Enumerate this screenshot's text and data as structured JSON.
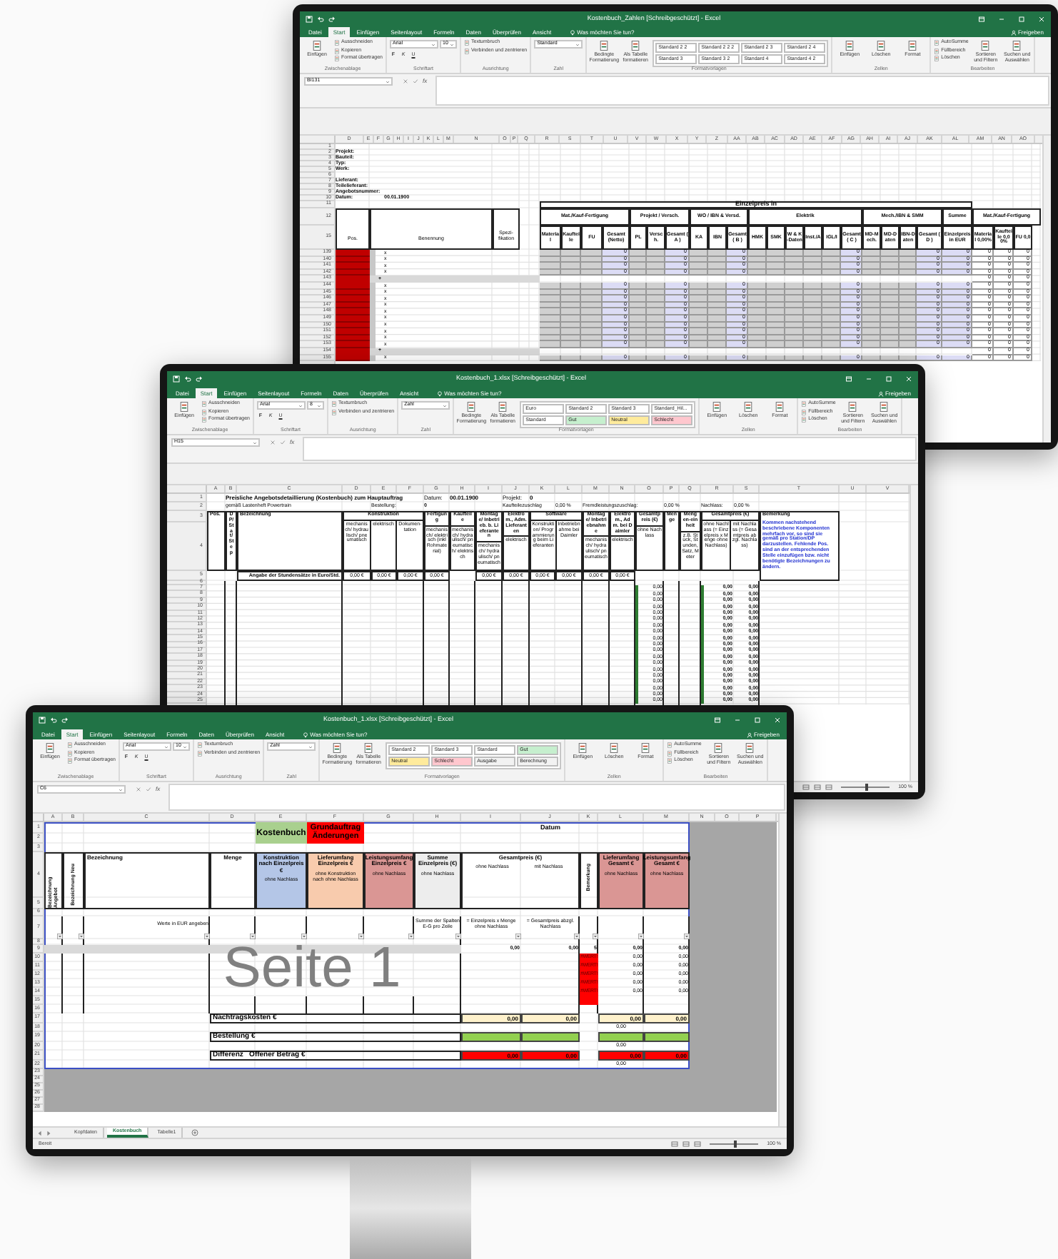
{
  "back_window": {
    "title": "Kostenbuch_Zahlen [Schreibgeschützt] - Excel",
    "tabs": [
      {
        "label": "Datei",
        "selected": false
      },
      {
        "label": "Start",
        "selected": true
      },
      {
        "label": "Einfügen",
        "selected": false
      },
      {
        "label": "Seitenlayout",
        "selected": false
      },
      {
        "label": "Formeln",
        "selected": false
      },
      {
        "label": "Daten",
        "selected": false
      },
      {
        "label": "Überprüfen",
        "selected": false
      },
      {
        "label": "Ansicht",
        "selected": false
      }
    ],
    "tell_me": "Was möchten Sie tun?",
    "share": "Freigeben",
    "ribbon": [
      {
        "label": "Zwischenablage",
        "big": [
          "Einfügen"
        ],
        "items": [
          "Ausschneiden",
          "Kopieren",
          "Format übertragen"
        ]
      },
      {
        "label": "Schriftart",
        "fields": [
          "Arial",
          "10"
        ],
        "buttons": [
          "F",
          "K",
          "U"
        ]
      },
      {
        "label": "Ausrichtung",
        "items": [
          "Textumbruch",
          "Verbinden und zentrieren"
        ]
      },
      {
        "label": "Zahl",
        "fields": [
          "Standard"
        ]
      },
      {
        "label": "Formatvorlagen",
        "big": [
          "Bedingte Formatierung",
          "Als Tabelle formatieren"
        ],
        "styles": [
          {
            "label": "Standard 2 2",
            "color": "#ffffff"
          },
          {
            "label": "Standard 2 2 2",
            "color": "#ffffff"
          },
          {
            "label": "Standard 2 3",
            "color": "#ffffff"
          },
          {
            "label": "Standard 2 4",
            "color": "#ffffff"
          },
          {
            "label": "Standard 3",
            "color": "#ffffff"
          },
          {
            "label": "Standard 3 2",
            "color": "#ffffff"
          },
          {
            "label": "Standard 4",
            "color": "#ffffff"
          },
          {
            "label": "Standard 4 2",
            "color": "#ffffff"
          }
        ]
      },
      {
        "label": "Zellen",
        "big": [
          "Einfügen",
          "Löschen",
          "Format"
        ]
      },
      {
        "label": "Bearbeiten",
        "items": [
          "AutoSumme",
          "Füllbereich",
          "Löschen"
        ],
        "big": [
          "Sortieren und Filtern",
          "Suchen und Auswählen"
        ]
      }
    ],
    "name_box": "BI131",
    "fx": "fx",
    "columns": [
      "D",
      "E",
      "F",
      "G",
      "H",
      "I",
      "J",
      "K",
      "L",
      "M",
      "N",
      "O",
      "P",
      "Q",
      "R",
      "S",
      "T",
      "U",
      "V",
      "W",
      "X",
      "Y",
      "Z",
      "AA",
      "AB",
      "AC",
      "AD",
      "AE",
      "AF",
      "AG",
      "AH",
      "AI",
      "AJ",
      "AK",
      "AL",
      "AM",
      "AN",
      "AO"
    ],
    "rows": [
      "1",
      "2",
      "3",
      "4",
      "5",
      "6",
      "7",
      "8",
      "9",
      "10",
      "11",
      "12",
      "15",
      "139",
      "140",
      "141",
      "142",
      "143",
      "144",
      "145",
      "146",
      "147",
      "148",
      "149",
      "150",
      "151",
      "152",
      "153",
      "154",
      "155"
    ],
    "sheet": {
      "info": [
        {
          "label": "Projekt:"
        },
        {
          "label": "Bauteil:"
        },
        {
          "label": "Typ:"
        },
        {
          "label": "Werk:"
        },
        {
          "label": "Lieferant:"
        },
        {
          "label": "Teilelieferant:"
        },
        {
          "label": "Angebotsnummer:"
        },
        {
          "label": "Datum:",
          "value": "00.01.1900"
        }
      ],
      "table_title": "Einzelpreis in",
      "groups": [
        "Mat./Kauf-Fertigung",
        "Projekt / Versch.",
        "WO / IBN & Versd.",
        "Elektrik",
        "Mech./IBN & SMM",
        "Summe",
        "Mat./Kauf-Fertigung"
      ],
      "row_headers": [
        "Pos.",
        "Benennung",
        "Spezi-fikation"
      ],
      "subheaders": [
        "Material",
        "Kaufteile",
        "FU",
        "Gesamt (Netto)",
        "PL",
        "Versch.",
        "Gesamt ( A )",
        "KA",
        "IBN",
        "Gesamt ( B )",
        "HMK",
        "SMK",
        "W & K-Daten",
        "Inst./A",
        "IGL/I",
        "Gesamt ( C )",
        "MD-Mech.",
        "MD-Daten",
        "IBN-Daten",
        "Gesamt ( D )",
        "Einzelpreis in EUR",
        "Material 0,00%",
        "Kaufteile 0,00%",
        "FU 0,0"
      ],
      "rows": [
        {
          "kind": "item",
          "mark": "x",
          "values": [
            "0",
            "0",
            "0",
            "0",
            "0",
            "0",
            "0",
            "0",
            "0"
          ]
        },
        {
          "kind": "item",
          "mark": "x",
          "values": [
            "0",
            "0",
            "0",
            "0",
            "0",
            "0",
            "0",
            "0",
            "0"
          ]
        },
        {
          "kind": "item",
          "mark": "x",
          "values": [
            "0",
            "0",
            "0",
            "0",
            "0",
            "0",
            "0",
            "0",
            "0"
          ]
        },
        {
          "kind": "item",
          "mark": "x",
          "values": [
            "0",
            "0",
            "0",
            "0",
            "0",
            "0",
            "0",
            "0",
            "0"
          ]
        },
        {
          "kind": "group",
          "mark": "+",
          "values": [
            "0",
            "0",
            "0"
          ]
        },
        {
          "kind": "item",
          "mark": "x",
          "values": [
            "0",
            "0",
            "0",
            "0",
            "0",
            "0",
            "0",
            "0",
            "0"
          ]
        },
        {
          "kind": "item",
          "mark": "x",
          "values": [
            "0",
            "0",
            "0",
            "0",
            "0",
            "0",
            "0",
            "0",
            "0"
          ]
        },
        {
          "kind": "item",
          "mark": "x",
          "values": [
            "0",
            "0",
            "0",
            "0",
            "0",
            "0",
            "0",
            "0",
            "0"
          ]
        },
        {
          "kind": "item",
          "mark": "x",
          "values": [
            "0",
            "0",
            "0",
            "0",
            "0",
            "0",
            "0",
            "0",
            "0"
          ]
        },
        {
          "kind": "item",
          "mark": "x",
          "values": [
            "0",
            "0",
            "0",
            "0",
            "0",
            "0",
            "0",
            "0",
            "0"
          ]
        },
        {
          "kind": "item",
          "mark": "x",
          "values": [
            "0",
            "0",
            "0",
            "0",
            "0",
            "0",
            "0",
            "0",
            "0"
          ]
        },
        {
          "kind": "item",
          "mark": "x",
          "values": [
            "0",
            "0",
            "0",
            "0",
            "0",
            "0",
            "0",
            "0",
            "0"
          ]
        },
        {
          "kind": "item",
          "mark": "x",
          "values": [
            "0",
            "0",
            "0",
            "0",
            "0",
            "0",
            "0",
            "0",
            "0"
          ]
        },
        {
          "kind": "item",
          "mark": "x",
          "values": [
            "0",
            "0",
            "0",
            "0",
            "0",
            "0",
            "0",
            "0",
            "0"
          ]
        },
        {
          "kind": "item",
          "mark": "x",
          "values": [
            "0",
            "0",
            "0",
            "0",
            "0",
            "0",
            "0",
            "0",
            "0"
          ]
        },
        {
          "kind": "group",
          "mark": "+",
          "values": [
            "0",
            "0",
            "0"
          ]
        },
        {
          "kind": "item",
          "mark": "x",
          "values": [
            "0",
            "0",
            "0",
            "0",
            "0",
            "0",
            "0",
            "0",
            "0"
          ]
        }
      ]
    }
  },
  "middle_window": {
    "title": "Kostenbuch_1.xlsx [Schreibgeschützt] - Excel",
    "tabs": [
      {
        "label": "Datei",
        "selected": false
      },
      {
        "label": "Start",
        "selected": true
      },
      {
        "label": "Einfügen",
        "selected": false
      },
      {
        "label": "Seitenlayout",
        "selected": false
      },
      {
        "label": "Formeln",
        "selected": false
      },
      {
        "label": "Daten",
        "selected": false
      },
      {
        "label": "Überprüfen",
        "selected": false
      },
      {
        "label": "Ansicht",
        "selected": false
      }
    ],
    "tell_me": "Was möchten Sie tun?",
    "share": "Freigeben",
    "ribbon": [
      {
        "label": "Zwischenablage",
        "big": [
          "Einfügen"
        ],
        "items": [
          "Ausschneiden",
          "Kopieren",
          "Format übertragen"
        ]
      },
      {
        "label": "Schriftart",
        "fields": [
          "Arial",
          "8"
        ],
        "buttons": [
          "F",
          "K",
          "U"
        ]
      },
      {
        "label": "Ausrichtung",
        "items": [
          "Textumbruch",
          "Verbinden und zentrieren"
        ]
      },
      {
        "label": "Zahl",
        "fields": [
          "Zahl"
        ]
      },
      {
        "label": "Formatvorlagen",
        "big": [
          "Bedingte Formatierung",
          "Als Tabelle formatieren"
        ],
        "styles": [
          {
            "label": "Euro",
            "color": "#ffffff"
          },
          {
            "label": "Standard 2",
            "color": "#ffffff"
          },
          {
            "label": "Standard 3",
            "color": "#ffffff"
          },
          {
            "label": "Standard_Hil...",
            "color": "#ffffff"
          },
          {
            "label": "Standard",
            "color": "#ffffff"
          },
          {
            "label": "Gut",
            "color": "#c6efce"
          },
          {
            "label": "Neutral",
            "color": "#ffeb9c"
          },
          {
            "label": "Schlecht",
            "color": "#ffc7ce"
          }
        ]
      },
      {
        "label": "Zellen",
        "big": [
          "Einfügen",
          "Löschen",
          "Format"
        ]
      },
      {
        "label": "Bearbeiten",
        "items": [
          "AutoSumme",
          "Füllbereich",
          "Löschen"
        ],
        "big": [
          "Sortieren und Filtern",
          "Suchen und Auswählen"
        ]
      }
    ],
    "name_box": "H15",
    "fx": "fx",
    "columns": [
      "A",
      "B",
      "C",
      "D",
      "E",
      "F",
      "G",
      "H",
      "I",
      "J",
      "K",
      "L",
      "M",
      "N",
      "O",
      "P",
      "Q",
      "R",
      "S",
      "T",
      "U",
      "V"
    ],
    "rows": [
      "1",
      "2",
      "3",
      "4",
      "5",
      "6",
      "7",
      "8",
      "9",
      "10",
      "11",
      "12",
      "13",
      "14",
      "15",
      "16",
      "17",
      "18",
      "19",
      "20",
      "21",
      "22",
      "23",
      "24",
      "25"
    ],
    "sheet": {
      "line_1": [
        {
          "text": "Preisliche Angebotsdetaillierung (Kostenbuch) zum Hauptauftrag",
          "bold": true
        },
        {
          "text": "Datum:",
          "bold": false
        },
        {
          "text": "00.01.1900",
          "bold": true
        },
        {
          "text": "Projekt:",
          "bold": false
        },
        {
          "text": "0",
          "bold": true
        }
      ],
      "line_2": [
        {
          "text": "gemäß Lastenheft Powertrain",
          "bold": false
        },
        {
          "text": "Bestellung:",
          "bold": false
        },
        {
          "text": "0",
          "bold": true
        },
        {
          "text": "Kaufteilezuschlag",
          "bold": false
        },
        {
          "text": "0,00 %",
          "bold": false
        },
        {
          "text": "Fremdleistungszuschlag:",
          "bold": false
        },
        {
          "text": "0,00 %",
          "bold": false
        },
        {
          "text": "Nachlass:",
          "bold": false
        },
        {
          "text": "0,00 %",
          "bold": false
        }
      ],
      "headers": [
        {
          "label": "Pos."
        },
        {
          "label": "DP/ Stat/ Step"
        },
        {
          "label": "Bezeichnung"
        },
        {
          "label": "Konstruktion",
          "subs": [
            "mechanisch/ hydraulisch/ pneumatisch",
            "elektrisch",
            "Dokumen-tation"
          ]
        },
        {
          "label": "Fertigung",
          "subs": [
            "mechanisch/ elektrisch (inkl Rohmaterial)"
          ]
        },
        {
          "label": "Kaufteile",
          "subs": [
            "mechanisch/ hydraulisch/ pneumatisch/ elektrisch"
          ]
        },
        {
          "label": "Montage/ Inbetrieb. b. Lieferanten",
          "subs": [
            "mechanisch/ hydraulisch/ pneumatisch"
          ]
        },
        {
          "label": "Elektrom., Adm. Lieferanten",
          "subs": [
            "elektrisch"
          ]
        },
        {
          "label": "Software",
          "subs": [
            "Konstruktion/ Programmierung beim Lieferanten",
            "Inbetriebnahme bei Daimler"
          ]
        },
        {
          "label": "Montage/ Inbetriebnahme",
          "subs": [
            "mechanisch/ hydraulisch/ pneumatisch"
          ]
        },
        {
          "label": "Elektrom., Adm. bei Daimler",
          "subs": [
            "elektrisch"
          ]
        },
        {
          "label": "Gesamtpreis (€)",
          "subs": [
            "ohne Nachlass"
          ]
        },
        {
          "label": "Menge"
        },
        {
          "label": "Mengen-einheit",
          "subs": [
            "z.B. Stück, Stunden, Satz, Meter"
          ]
        },
        {
          "label": "Gesamtpreis (€)",
          "subs": [
            "ohne Nachlass (= Einzelpreis x Menge ohne Nachlass)",
            "mit Nachlass (= Gesamtpreis abzgl. Nachlass)"
          ]
        },
        {
          "label": "Bemerkung",
          "note": "Kommen nachstehend beschriebene Komponenten mehrfach vor, so sind sie gemäß pro Station/DP darzustellen. Fehlende Pos. sind an der entsprechenden Stelle einzufügen bzw. nicht benötigte Bezeichnungen zu ändern."
        }
      ],
      "rate_label": "Angabe der Stundensätze in Euro/Std.",
      "rates": [
        "0,00 €",
        "0,00 €",
        "0,00 €",
        "0,00 €",
        "0,00 €",
        "0,00 €",
        "0,00 €",
        "0,00 €",
        "0,00 €",
        "0,00 €"
      ],
      "rows": [
        {
          "total": "0,00",
          "without": "0,00",
          "with": "0,00"
        },
        {
          "total": "0,00",
          "without": "0,00",
          "with": "0,00"
        },
        {
          "total": "0,00",
          "without": "0,00",
          "with": "0,00"
        },
        {
          "total": "0,00",
          "without": "0,00",
          "with": "0,00"
        },
        {
          "total": "0,00",
          "without": "0,00",
          "with": "0,00"
        },
        {
          "total": "0,00",
          "without": "0,00",
          "with": "0,00"
        },
        {
          "total": "0,00",
          "without": "0,00",
          "with": "0,00"
        },
        {
          "total": "0,00",
          "without": "0,00",
          "with": "0,00"
        },
        {
          "total": "0,00",
          "without": "0,00",
          "with": "0,00"
        },
        {
          "total": "0,00",
          "without": "0,00",
          "with": "0,00"
        },
        {
          "total": "0,00",
          "without": "0,00",
          "with": "0,00"
        },
        {
          "total": "0,00",
          "without": "0,00",
          "with": "0,00"
        },
        {
          "total": "0,00",
          "without": "0,00",
          "with": "0,00"
        },
        {
          "total": "0,00",
          "without": "0,00",
          "with": "0,00"
        },
        {
          "total": "0,00",
          "without": "0,00",
          "with": "0,00"
        },
        {
          "total": "0,00",
          "without": "0,00",
          "with": "0,00"
        },
        {
          "total": "0,00",
          "without": "0,00",
          "with": "0,00"
        },
        {
          "total": "0,00",
          "without": "0,00",
          "with": "0,00"
        },
        {
          "total": "0,00",
          "without": "0,00",
          "with": "0,00"
        }
      ]
    },
    "zoom": "100 %",
    "zoom_slider": {
      "level": 0.5
    }
  },
  "front_window": {
    "title": "Kostenbuch_1.xlsx [Schreibgeschützt] - Excel",
    "tabs": [
      {
        "label": "Datei",
        "selected": false
      },
      {
        "label": "Start",
        "selected": true
      },
      {
        "label": "Einfügen",
        "selected": false
      },
      {
        "label": "Seitenlayout",
        "selected": false
      },
      {
        "label": "Formeln",
        "selected": false
      },
      {
        "label": "Daten",
        "selected": false
      },
      {
        "label": "Überprüfen",
        "selected": false
      },
      {
        "label": "Ansicht",
        "selected": false
      }
    ],
    "tell_me": "Was möchten Sie tun?",
    "share": "Freigeben",
    "ribbon": [
      {
        "label": "Zwischenablage",
        "big": [
          "Einfügen"
        ],
        "items": [
          "Ausschneiden",
          "Kopieren",
          "Format übertragen"
        ]
      },
      {
        "label": "Schriftart",
        "fields": [
          "Arial",
          "10"
        ],
        "buttons": [
          "F",
          "K",
          "U"
        ]
      },
      {
        "label": "Ausrichtung",
        "items": [
          "Textumbruch",
          "Verbinden und zentrieren"
        ]
      },
      {
        "label": "Zahl",
        "fields": [
          "Zahl"
        ]
      },
      {
        "label": "Formatvorlagen",
        "big": [
          "Bedingte Formatierung",
          "Als Tabelle formatieren"
        ],
        "styles": [
          {
            "label": "Standard 2",
            "color": "#ffffff"
          },
          {
            "label": "Standard 3",
            "color": "#ffffff"
          },
          {
            "label": "Standard",
            "color": "#ffffff"
          },
          {
            "label": "Gut",
            "color": "#c6efce"
          },
          {
            "label": "Neutral",
            "color": "#ffeb9c"
          },
          {
            "label": "Schlecht",
            "color": "#ffc7ce"
          },
          {
            "label": "Ausgabe",
            "color": "#f2f2f2"
          },
          {
            "label": "Berechnung",
            "color": "#f2f2f2"
          }
        ]
      },
      {
        "label": "Zellen",
        "big": [
          "Einfügen",
          "Löschen",
          "Format"
        ]
      },
      {
        "label": "Bearbeiten",
        "items": [
          "AutoSumme",
          "Füllbereich",
          "Löschen"
        ],
        "big": [
          "Sortieren und Filtern",
          "Suchen und Auswählen"
        ]
      }
    ],
    "name_box": "C6",
    "fx": "fx",
    "columns": [
      "A",
      "B",
      "C",
      "D",
      "E",
      "F",
      "G",
      "H",
      "I",
      "J",
      "K",
      "L",
      "M",
      "N",
      "O",
      "P"
    ],
    "rows": [
      "1",
      "2",
      "3",
      "4",
      "5",
      "6",
      "7",
      "8",
      "9",
      "10",
      "11",
      "12",
      "13",
      "14",
      "15",
      "16",
      "17",
      "18",
      "19",
      "20",
      "21",
      "22",
      "23",
      "24",
      "25",
      "26",
      "27",
      "28"
    ],
    "sheet": {
      "title_block": {
        "book": "Kostenbuch",
        "order": "Grundauftrag Änderungen",
        "date_label": "Datum"
      },
      "headers": [
        {
          "label": "Bezeichnung Angebot",
          "kind": "rotated"
        },
        {
          "label": "Bezeichnung Neu",
          "kind": "rotated"
        },
        {
          "label": "Bezeichnung",
          "kind": "left"
        },
        {
          "label": "Menge",
          "kind": "center"
        },
        {
          "label": "Konstruktion nach Einzelpreis €",
          "note": "ohne Nachlass",
          "kind": "center",
          "color": "#b4c6e7"
        },
        {
          "label": "Lieferumfang Einzelpreis €",
          "note": "ohne Konstruktion nach ohne Nachlass",
          "kind": "center",
          "color": "#f8cbad"
        },
        {
          "label": "Leistungsumfang Einzelpreis €",
          "note": "ohne Nachlass",
          "kind": "center",
          "color": "#da9694"
        },
        {
          "label": "Summe Einzelpreis (€)",
          "note": "ohne Nachlass",
          "kind": "center",
          "color": "#ededed"
        },
        {
          "label": "Gesamtpreis (€)",
          "subs": [
            "ohne Nachlass",
            "mit Nachlass"
          ],
          "kind": "center"
        },
        {
          "label": "Bemerkung",
          "kind": "rotated"
        },
        {
          "label": "Lieferumfang Gesamt €",
          "note": "ohne Nachlass",
          "kind": "center",
          "color": "#da9694"
        },
        {
          "label": "Leistungsumfang Gesamt €",
          "note": "ohne Nachlass",
          "kind": "center",
          "color": "#da9694"
        }
      ],
      "hints": [
        "Werte in EUR angeben",
        "Summe der Spalten E-G pro Zeile",
        "= Einzelpreis x Menge ohne Nachlass",
        "= Gesamtpreis abzgl. Nachlass"
      ],
      "page_label": "Seite 1",
      "first_row": {
        "total_without": "0,00",
        "total_with": "0,00",
        "remark": "5",
        "delivery": "0,00",
        "service": "0,00"
      },
      "rows": [
        {
          "error": true,
          "flag": "#WERT!",
          "delivery": "0,00",
          "service": "0,00"
        },
        {
          "error": true,
          "flag": "#WERT!",
          "delivery": "0,00",
          "service": "0,00"
        },
        {
          "error": true,
          "flag": "#WERT!",
          "delivery": "0,00",
          "service": "0,00"
        },
        {
          "error": true,
          "flag": "#WERT!",
          "delivery": "0,00",
          "service": "0,00"
        },
        {
          "error": true,
          "flag": "#WERT!",
          "delivery": "0,00",
          "service": "0,00"
        },
        {
          "error": true
        }
      ],
      "totals": [
        {
          "label": "Nachtragskosten €",
          "kind": "cost",
          "values": [
            "0,00",
            "0,00",
            "0,00",
            "0,00"
          ],
          "below": "0,00"
        },
        {
          "label": "Bestellung €",
          "kind": "order",
          "below": "0,00"
        },
        {
          "label": "Differenz   Offener Betrag €",
          "kind": "difference",
          "values": [
            "0,00",
            "0,00",
            "0,00",
            "0,00"
          ],
          "below": "0,00"
        }
      ]
    },
    "sheet_tabs": [
      {
        "label": "Kopfdaten",
        "selected": false
      },
      {
        "label": "Kostenbuch",
        "selected": true
      },
      {
        "label": "Tabelle1",
        "selected": false
      }
    ],
    "status": "Bereit",
    "zoom": "100 %",
    "zoom_slider": {
      "level": 0.5
    }
  }
}
